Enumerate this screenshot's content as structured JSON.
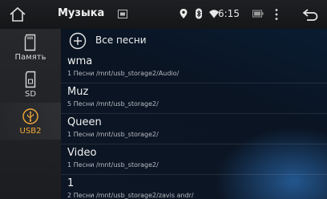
{
  "statusbar": {
    "title": "Музыка",
    "time": "6:15"
  },
  "sidebar": {
    "items": [
      {
        "label": "Память",
        "icon": "sd-card-icon"
      },
      {
        "label": "SD",
        "icon": "sd-card-icon"
      },
      {
        "label": "USB2",
        "icon": "usb-icon",
        "active": true
      }
    ]
  },
  "content": {
    "all_songs_label": "Все песни",
    "folders": [
      {
        "name": "wma",
        "info": "1 Песни /mnt/usb_storage2/Audio/"
      },
      {
        "name": "Muz",
        "info": "5 Песни /mnt/usb_storage2/"
      },
      {
        "name": "Queen",
        "info": "1 Песни /mnt/usb_storage2/"
      },
      {
        "name": "Video",
        "info": "1 Песни /mnt/usb_storage2/"
      },
      {
        "name": "1",
        "info": "2 Песни /mnt/usb_storage2/zavis andr/"
      }
    ]
  },
  "colors": {
    "accent": "#f2a93a",
    "statusbar_bg": "#1a1c1f",
    "content_bg": "#0a1628"
  }
}
